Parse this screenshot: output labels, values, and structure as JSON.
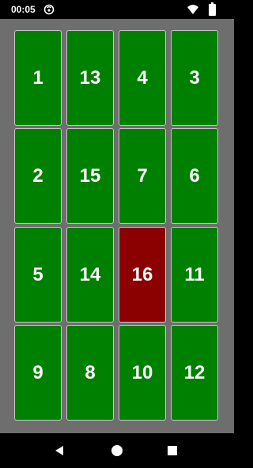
{
  "status_bar": {
    "time": "00:05",
    "icons": [
      "app-notification-icon",
      "wifi-icon",
      "battery-icon"
    ]
  },
  "board": {
    "colors": {
      "background": "#6e6e6e",
      "tile": "#008000",
      "tile_highlight": "#8b0000",
      "tile_text": "#ffffff"
    },
    "rows": [
      [
        {
          "label": "1"
        },
        {
          "label": "13"
        },
        {
          "label": "4"
        },
        {
          "label": "3"
        }
      ],
      [
        {
          "label": "2"
        },
        {
          "label": "15"
        },
        {
          "label": "7"
        },
        {
          "label": "6"
        }
      ],
      [
        {
          "label": "5"
        },
        {
          "label": "14"
        },
        {
          "label": "16",
          "highlighted": true
        },
        {
          "label": "11"
        }
      ],
      [
        {
          "label": "9"
        },
        {
          "label": "8"
        },
        {
          "label": "10"
        },
        {
          "label": "12"
        }
      ]
    ]
  },
  "nav_bar": {
    "buttons": [
      "back-icon",
      "home-icon",
      "recents-icon"
    ]
  }
}
